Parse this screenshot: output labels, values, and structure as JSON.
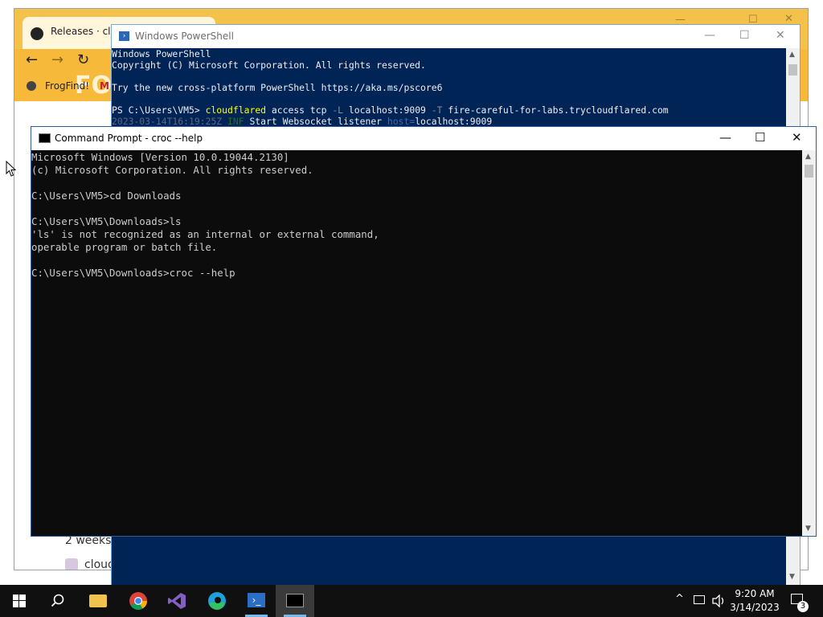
{
  "browser": {
    "tab_title": "Releases · cloud",
    "bookmark_1": "FrogFind!",
    "bookmark_logo_text": "FO",
    "content_text_1": "2 weeks",
    "content_text_2": "cloud"
  },
  "powershell": {
    "title": "Windows PowerShell",
    "lines": [
      "Windows PowerShell",
      "Copyright (C) Microsoft Corporation. All rights reserved.",
      "",
      "Try the new cross-platform PowerShell https://aka.ms/pscore6",
      ""
    ],
    "command": {
      "prompt": "PS C:\\Users\\VM5> ",
      "exe": "cloudflared",
      "arg1": " access tcp ",
      "flag1": "-L",
      "arg2": " localhost:9009 ",
      "flag2": "-T",
      "arg3": " fire-careful-for-labs.trycloudflared.com"
    },
    "log": {
      "timestamp": "2023-03-14T16:19:25Z",
      "level": "INF",
      "message": " Start Websocket listener ",
      "key": "host=",
      "value": "localhost:9009"
    },
    "colors": {
      "background": "#012456",
      "exe": "#ffff00",
      "flag": "#8c8c8c",
      "timestamp": "#5c6680",
      "level": "#2b6b2b",
      "key": "#3f6ca8"
    }
  },
  "cmd": {
    "title": "Command Prompt - croc  --help",
    "lines": [
      "Microsoft Windows [Version 10.0.19044.2130]",
      "(c) Microsoft Corporation. All rights reserved.",
      "",
      "C:\\Users\\VM5>cd Downloads",
      "",
      "C:\\Users\\VM5\\Downloads>ls",
      "'ls' is not recognized as an internal or external command,",
      "operable program or batch file.",
      "",
      "C:\\Users\\VM5\\Downloads>croc --help"
    ]
  },
  "taskbar": {
    "apps": [
      "start-icon",
      "search-icon",
      "file-explorer-icon",
      "chrome-icon",
      "visual-studio-icon",
      "edge-icon",
      "powershell-icon",
      "command-prompt-icon"
    ],
    "time": "9:20 AM",
    "date": "3/14/2023",
    "notification_count": "3"
  }
}
